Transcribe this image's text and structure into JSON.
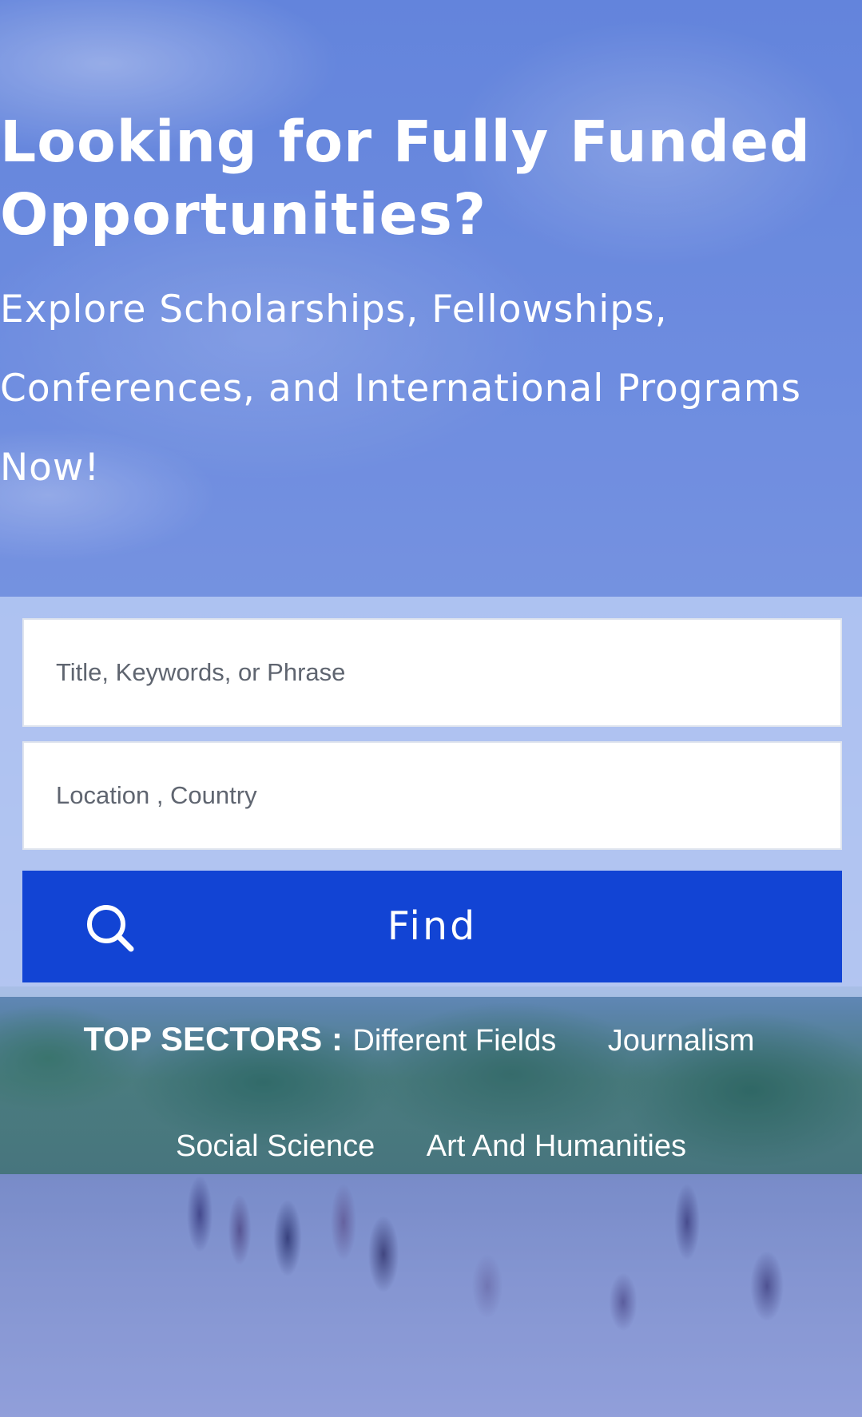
{
  "hero": {
    "title": "Looking for Fully Funded Opportunities?",
    "subtitle": "Explore Scholarships, Fellowships, Conferences, and International Programs Now!"
  },
  "search": {
    "keywords_placeholder": "Title, Keywords, or Phrase",
    "keywords_value": "",
    "location_placeholder": "Location , Country",
    "location_value": "",
    "find_label": "Find",
    "find_icon": "search-icon"
  },
  "sectors": {
    "heading": "TOP SECTORS :",
    "items": [
      "Different Fields",
      "Journalism",
      "Social Science",
      "Art And Humanities"
    ]
  },
  "colors": {
    "accent": "#1244d4",
    "hero_overlay": "#6f8fdf",
    "panel": "#c4d4f6"
  }
}
